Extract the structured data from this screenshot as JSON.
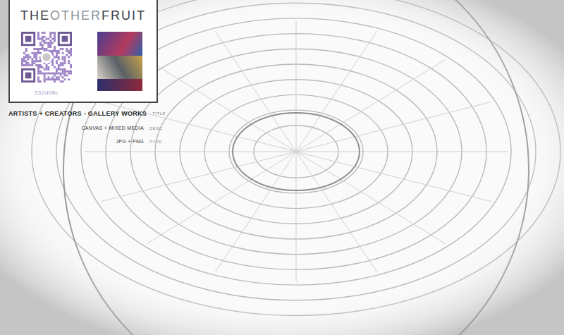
{
  "brand": {
    "parts": [
      {
        "text": "THE",
        "muted": false
      },
      {
        "text": "OTHER",
        "muted": true
      },
      {
        "text": "FRUIT",
        "muted": false
      }
    ]
  },
  "qr": {
    "code": "532d08c"
  },
  "details": [
    {
      "label": "TITLE",
      "value": "ARTISTS + CREATORS - GALLERY WORKS"
    },
    {
      "label": "DESC",
      "value": "CANVAS + MIXED MEDIA"
    },
    {
      "label": "TYPE",
      "value": "JPG + PNG"
    }
  ]
}
